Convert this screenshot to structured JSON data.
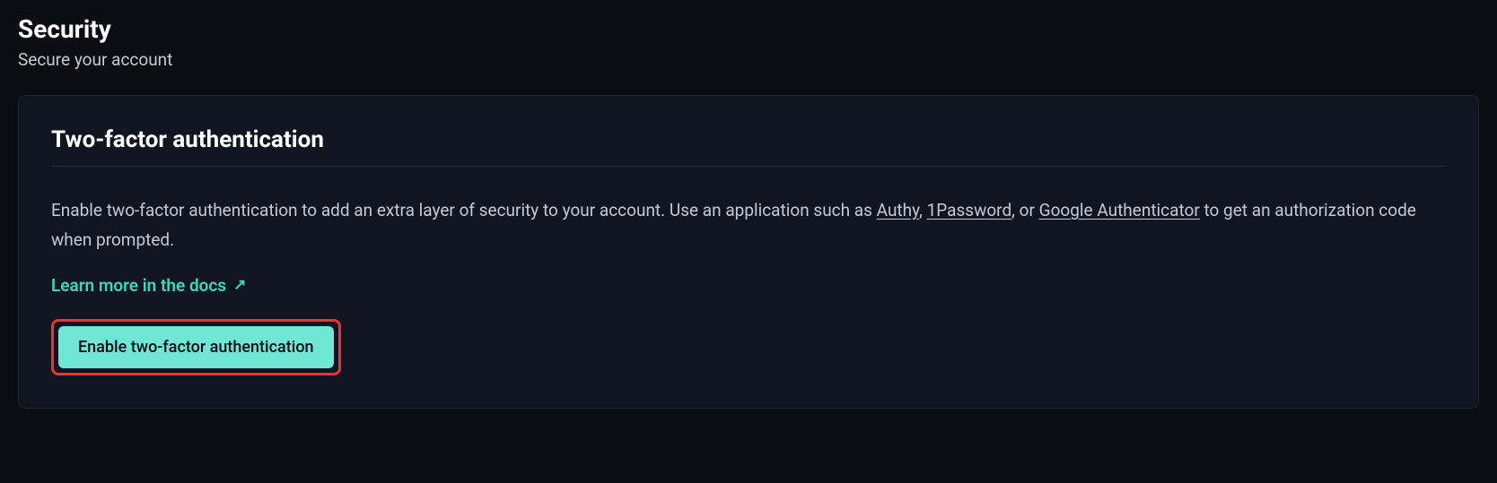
{
  "header": {
    "title": "Security",
    "subtitle": "Secure your account"
  },
  "card": {
    "title": "Two-factor authentication",
    "description": {
      "part1": "Enable two-factor authentication to add an extra layer of security to your account. Use an application such as ",
      "link1": "Authy",
      "sep1": ", ",
      "link2": "1Password",
      "sep2": ", or ",
      "link3": "Google Authenticator",
      "part2": " to get an authorization code when prompted."
    },
    "docs_link": "Learn more in the docs",
    "button_label": "Enable two-factor authentication"
  }
}
